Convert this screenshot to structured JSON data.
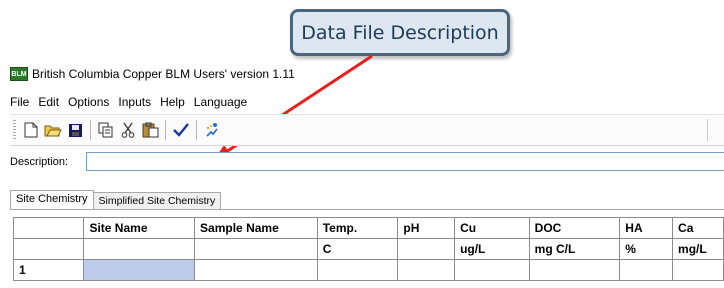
{
  "callout": {
    "text": "Data File Description"
  },
  "window": {
    "icon_text": "BLM",
    "title": "British Columbia Copper BLM Users' version 1.11"
  },
  "menu": [
    "File",
    "Edit",
    "Options",
    "Inputs",
    "Help",
    "Language"
  ],
  "toolbar": {
    "buttons": [
      "new-icon",
      "open-folder-icon",
      "save-icon",
      "copy-icon",
      "cut-icon",
      "paste-icon",
      "checkmark-icon",
      "run-icon"
    ]
  },
  "description": {
    "label": "Description:",
    "value": ""
  },
  "tabs": [
    {
      "label": "Site Chemistry",
      "active": true
    },
    {
      "label": "Simplified Site Chemistry",
      "active": false
    }
  ],
  "table": {
    "headers": [
      "",
      "Site Name",
      "Sample Name",
      "Temp.",
      "pH",
      "Cu",
      "DOC",
      "HA",
      "Ca"
    ],
    "units": [
      "",
      "",
      "",
      "C",
      "",
      "ug/L",
      "mg C/L",
      "%",
      "mg/L"
    ],
    "rows": [
      [
        "1",
        "",
        "",
        "",
        "",
        "",
        "",
        "",
        ""
      ]
    ]
  },
  "colors": {
    "accent": "#e8211c",
    "callout_border": "#4d6680",
    "callout_fill": "#dde7f1",
    "selection": "#bccbe9"
  }
}
